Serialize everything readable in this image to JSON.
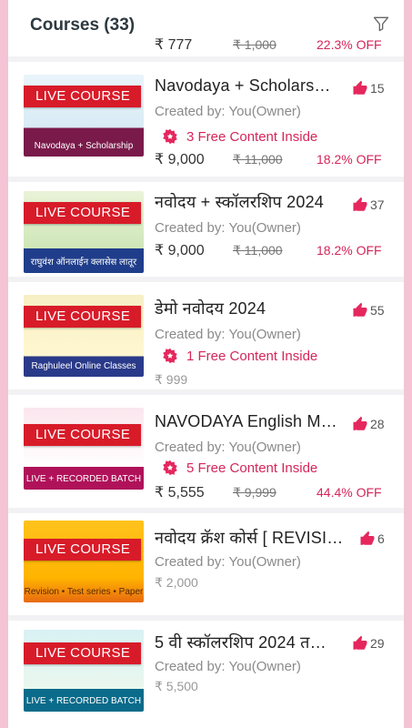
{
  "header": {
    "title": "Courses (33)"
  },
  "partial_card": {
    "price": "₹ 777",
    "mrp": "₹ 1,000",
    "discount": "22.3% OFF"
  },
  "cards": [
    {
      "live_label": "LIVE COURSE",
      "title": "Navodaya  + Scholars…",
      "likes": "15",
      "creator": "Created by: You(Owner)",
      "free_content": "3 Free Content Inside",
      "price": "₹ 9,000",
      "mrp": "₹ 11,000",
      "discount": "18.2% OFF",
      "thumb_caption": "Navodaya + Scholarship batch",
      "thumb_colors": [
        "#e9f4fb",
        "#7a1a4a"
      ]
    },
    {
      "live_label": "LIVE COURSE",
      "title": "नवोदय + स्कॉलरशिप 2024",
      "likes": "37",
      "creator": "Created by: You(Owner)",
      "price": "₹ 9,000",
      "mrp": "₹ 11,000",
      "discount": "18.2% OFF",
      "thumb_caption": "राघुवंश ऑनलाईन क्लासेस लातूर",
      "thumb_colors": [
        "#eaf3d8",
        "#1f3d8a"
      ]
    },
    {
      "live_label": "LIVE COURSE",
      "title": "डेमो नवोदय 2024",
      "likes": "55",
      "creator": "Created by: You(Owner)",
      "free_content": "1 Free Content Inside",
      "price": "₹ 999",
      "thumb_caption": "Raghuleel Online Classes Latur",
      "thumb_colors": [
        "#f6efc4",
        "#2a3a8a"
      ]
    },
    {
      "live_label": "LIVE COURSE",
      "title": "NAVODAYA English M…",
      "likes": "28",
      "creator": "Created by: You(Owner)",
      "free_content": "5 Free Content Inside",
      "price": "₹ 5,555",
      "mrp": "₹ 9,999",
      "discount": "44.4% OFF",
      "thumb_caption": "LIVE + RECORDED BATCH",
      "thumb_colors": [
        "#fbe6ee",
        "#b0125a"
      ]
    },
    {
      "live_label": "LIVE COURSE",
      "title": "नवोदय क्रॅश कोर्स [ REVISI…",
      "likes": "6",
      "creator": "Created by: You(Owner)",
      "price": "₹ 2,000",
      "thumb_caption": "Revision • Test series • Paper Solution",
      "thumb_colors": [
        "#ffc21c",
        "#e86a10"
      ]
    },
    {
      "live_label": "LIVE COURSE",
      "title": "5 वी स्कॉलरशिप 2024 त…",
      "likes": "29",
      "creator": "Created by: You(Owner)",
      "price": "₹ 5,500",
      "thumb_caption": "LIVE + RECORDED BATCH",
      "thumb_colors": [
        "#d9f1f4",
        "#0a6b8a"
      ]
    }
  ],
  "colors": {
    "accent": "#d52659",
    "badge": "#d81b29",
    "background": "#f4c4d4"
  }
}
